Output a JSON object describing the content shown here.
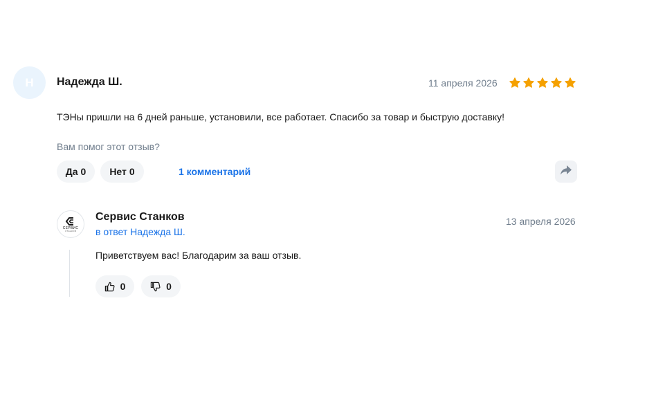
{
  "review": {
    "avatar_initial": "Н",
    "author": "Надежда Ш.",
    "date": "11 апреля 2026",
    "rating": 5,
    "rating_max": 5,
    "star_color": "#f5a100",
    "text": "ТЭНы пришли на 6 дней раньше, установили, все работает. Спасибо за товар и быструю доставку!",
    "helpful_question": "Вам помог этот отзыв?",
    "yes_label": "Да",
    "yes_count": "0",
    "no_label": "Нет",
    "no_count": "0",
    "comments_link": "1 комментарий",
    "share_icon": "share-icon"
  },
  "reply": {
    "logo_text": "СЕРВИС",
    "logo_subtext": "СТАНКОВ",
    "author": "Сервис Станков",
    "in_reply_to": "в ответ Надежда Ш.",
    "date": "13 апреля 2026",
    "text": "Приветствуем вас! Благодарим за ваш отзыв.",
    "likes": "0",
    "dislikes": "0"
  },
  "colors": {
    "accent_link": "#1a73e8",
    "muted_text": "#6f7d8c",
    "pill_bg": "#f3f5f7",
    "avatar_bg": "#eaf4fd"
  }
}
